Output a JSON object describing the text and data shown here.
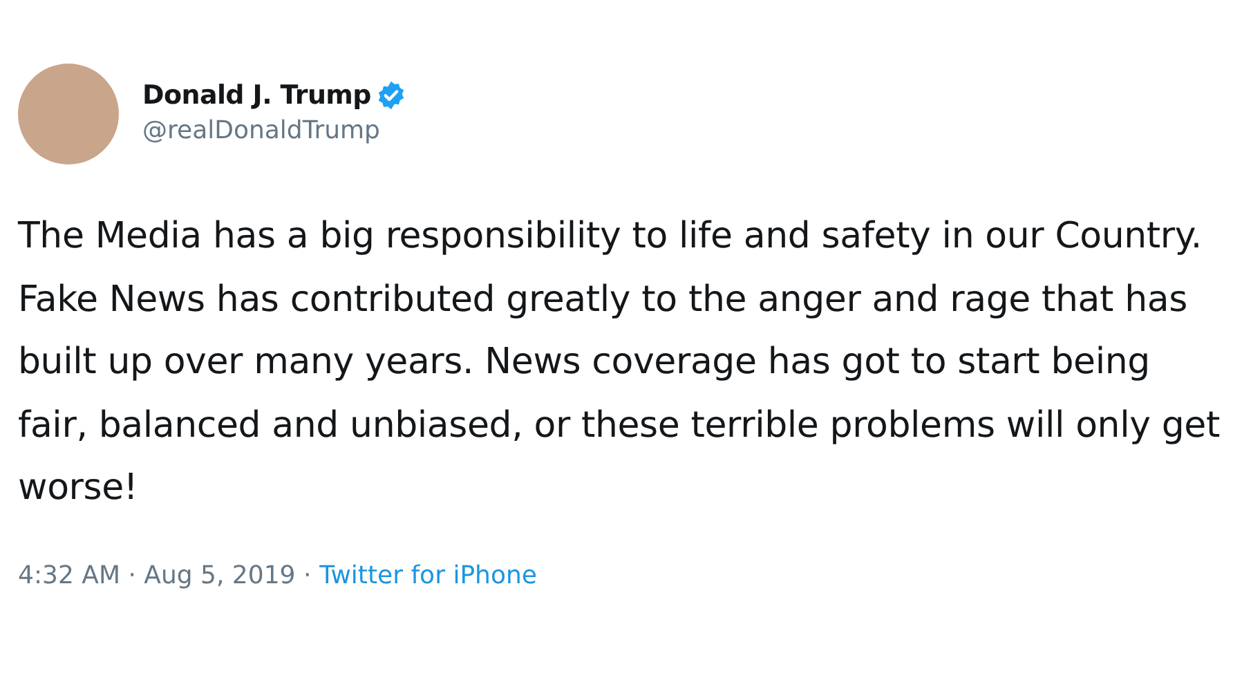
{
  "tweet": {
    "author": {
      "name": "Donald J. Trump",
      "handle": "@realDonaldTrump",
      "verified": true
    },
    "text": "The Media has a big responsibility to life and safety in our Country. Fake News has contributed greatly to the anger and rage that has built up over many years. News coverage has got to start being fair, balanced and unbiased, or these terrible problems will only get worse!",
    "timestamp": "4:32 AM · Aug 5, 2019 ·",
    "source": "Twitter for iPhone"
  }
}
